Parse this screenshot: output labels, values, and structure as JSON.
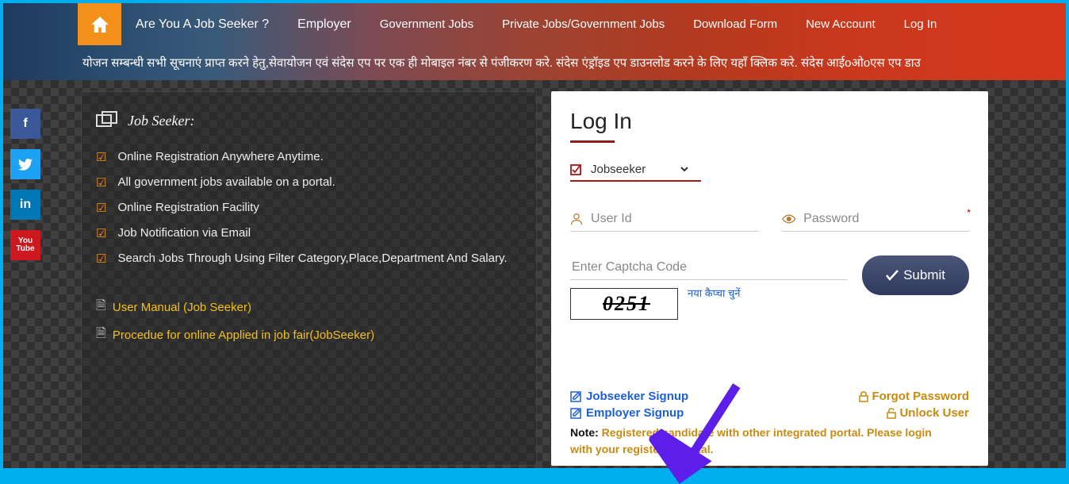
{
  "nav": {
    "items": [
      "Are You A Job Seeker ?",
      "Employer",
      "Government Jobs",
      "Private Jobs/Government Jobs",
      "Download Form",
      "New Account",
      "Log In"
    ]
  },
  "marquee": "योजन सम्बन्धी सभी सूचनाएं प्राप्त करने हेतु,सेवायोजन एवं संदेस एप पर एक ही मोबाइल नंबर से पंजीकरण करे.   संदेस एंड्रॉइड एप डाउनलोड करने के लिए यहाँ क्लिक करे.     संदेस आईoओoएस एप डाउ",
  "jobseeker_panel": {
    "title": "Job Seeker:",
    "features": [
      "Online Registration Anywhere Anytime.",
      "All government jobs available on a portal.",
      "Online Registration Facility",
      "Job Notification via Email",
      "Search Jobs Through Using Filter Category,Place,Department And Salary."
    ],
    "links": [
      "User Manual (Job Seeker)",
      "Procedue for online Applied in job fair(JobSeeker)"
    ]
  },
  "login": {
    "title": "Log In",
    "role_options": [
      "Jobseeker"
    ],
    "role_selected": "Jobseeker",
    "userid_placeholder": "User Id",
    "password_placeholder": "Password",
    "captcha_placeholder": "Enter Captcha Code",
    "captcha_value": "0251",
    "captcha_refresh": "नया कैप्चा चुनें",
    "submit_label": "Submit",
    "jobseeker_signup": "Jobseeker  Signup",
    "employer_signup": "Employer  Signup",
    "forgot_password": "Forgot Password",
    "unlock_user": "Unlock User",
    "note_label": "Note:",
    "note_text": " Registered candidate with other integrated portal. Please login with your registered portal."
  }
}
